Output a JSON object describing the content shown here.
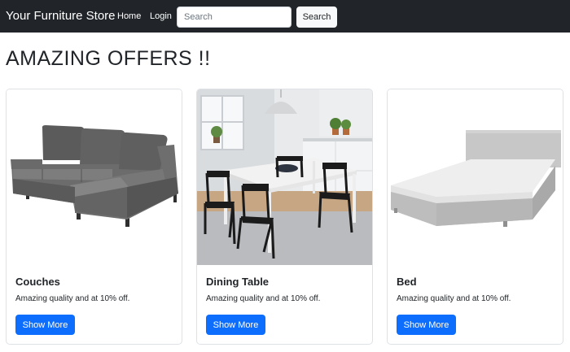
{
  "navbar": {
    "brand": "Your Furniture Store",
    "links": [
      "Home",
      "Login"
    ],
    "search": {
      "placeholder": "Search",
      "value": "",
      "button_label": "Search"
    }
  },
  "heading": "AMAZING OFFERS !!",
  "products": [
    {
      "title": "Couches",
      "description": "Amazing quality and at 10% off.",
      "button_label": "Show More",
      "image": "grey-sectional-couch"
    },
    {
      "title": "Dining Table",
      "description": "Amazing quality and at 10% off.",
      "button_label": "Show More",
      "image": "white-dining-table-with-black-chairs"
    },
    {
      "title": "Bed",
      "description": "Amazing quality and at 10% off.",
      "button_label": "Show More",
      "image": "grey-upholstered-bed"
    }
  ],
  "colors": {
    "navbar_bg": "#212529",
    "primary_button": "#0d6efd",
    "text": "#212529"
  }
}
